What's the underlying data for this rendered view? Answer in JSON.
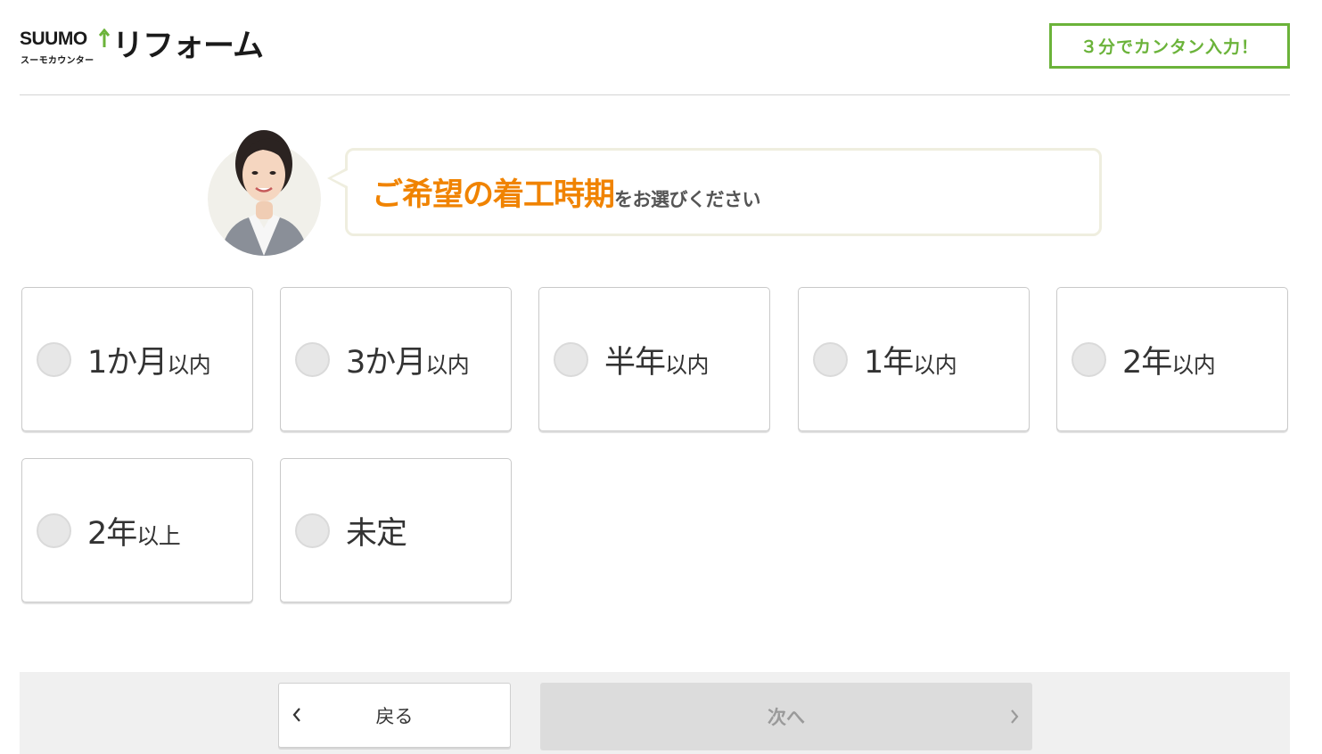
{
  "header": {
    "logo_suumo": "SUUMO",
    "logo_sub": "スーモカウンター",
    "logo_reform": "リフォーム",
    "badge": "３分でカンタン入力！",
    "accent_color": "#6bb33a"
  },
  "question": {
    "highlight": "ご希望の着工時期",
    "suffix": "をお選びください",
    "highlight_color": "#f08300"
  },
  "options": [
    {
      "main": "1か月",
      "sub": "以内",
      "selected": false
    },
    {
      "main": "3か月",
      "sub": "以内",
      "selected": false
    },
    {
      "main": "半年",
      "sub": "以内",
      "selected": false
    },
    {
      "main": "1年",
      "sub": "以内",
      "selected": false
    },
    {
      "main": "2年",
      "sub": "以内",
      "selected": false
    },
    {
      "main": "2年",
      "sub": "以上",
      "selected": false
    },
    {
      "main": "未定",
      "sub": "",
      "selected": false
    }
  ],
  "footer": {
    "back_label": "戻る",
    "next_label": "次へ",
    "next_enabled": false
  }
}
